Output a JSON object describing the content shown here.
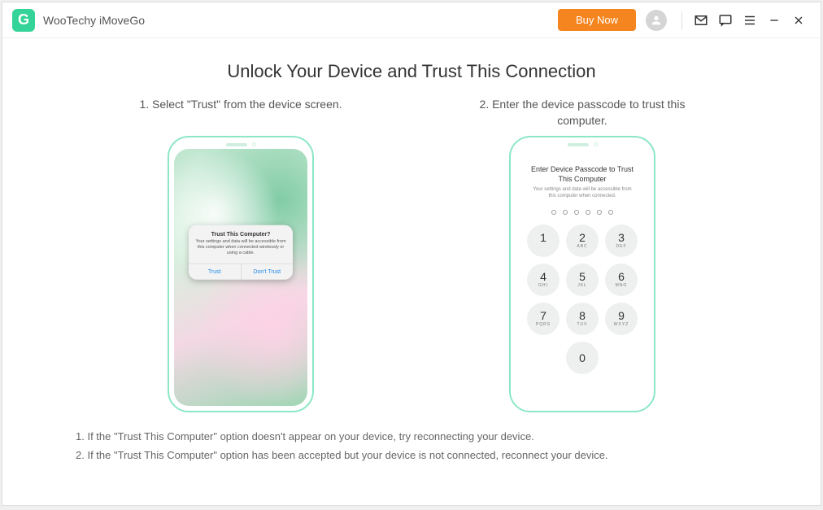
{
  "header": {
    "logo_letter": "G",
    "app_title": "WooTechy iMoveGo",
    "buy_label": "Buy Now"
  },
  "page": {
    "title": "Unlock Your Device and Trust This Connection"
  },
  "step1": {
    "label": "1. Select \"Trust\" from the device screen.",
    "alert_title": "Trust This Computer?",
    "alert_body": "Your settings and data will be accessible from this computer when connected wirelessly or using a cable.",
    "trust": "Trust",
    "dont_trust": "Don't Trust"
  },
  "step2": {
    "label": "2. Enter the device passcode to trust this computer.",
    "pc_title": "Enter Device Passcode to Trust This Computer",
    "pc_sub": "Your settings and data will be accessible from this computer when connected.",
    "keys": {
      "k1": "1",
      "k2": "2",
      "k3": "3",
      "k4": "4",
      "k5": "5",
      "k6": "6",
      "k7": "7",
      "k8": "8",
      "k9": "9",
      "k0": "0",
      "l2": "ABC",
      "l3": "DEF",
      "l4": "GHI",
      "l5": "JKL",
      "l6": "MNO",
      "l7": "PQRS",
      "l8": "TUV",
      "l9": "WXYZ"
    }
  },
  "notes": {
    "n1": "1. If the \"Trust This Computer\" option doesn't appear on your device, try reconnecting your device.",
    "n2": "2. If the \"Trust This Computer\" option has been accepted but your device is not connected, reconnect your device."
  }
}
